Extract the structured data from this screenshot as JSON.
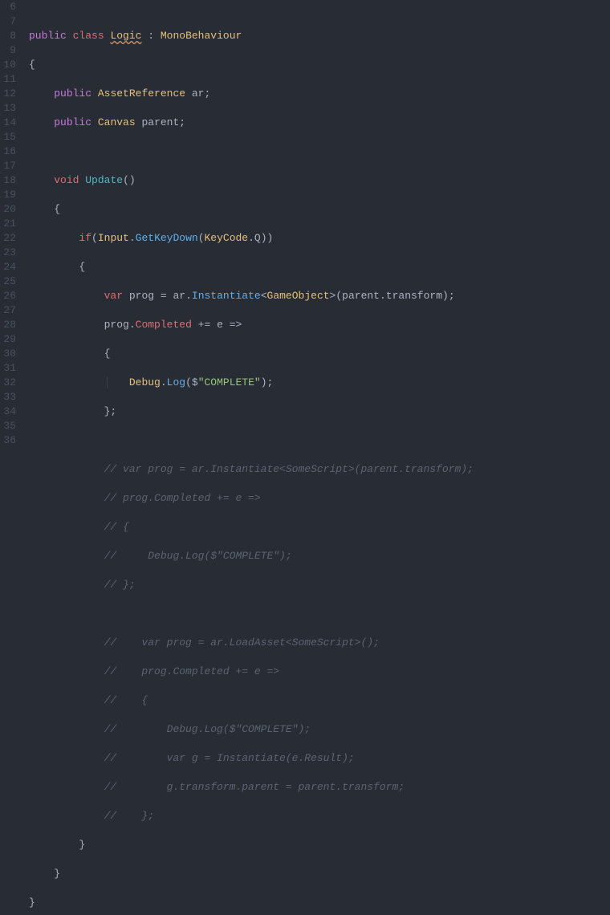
{
  "lines": {
    "start": 6,
    "end": 36
  },
  "code": {
    "l6": {
      "kw_public": "public",
      "kw_class": "class",
      "classname": "Logic",
      "colon": " : ",
      "base": "MonoBehaviour"
    },
    "l7": {
      "brace": "{"
    },
    "l8": {
      "kw_public": "public",
      "type": "AssetReference",
      "name": "ar",
      "semi": ";"
    },
    "l9": {
      "kw_public": "public",
      "type": "Canvas",
      "name": "parent",
      "semi": ";"
    },
    "l11": {
      "kw_void": "void",
      "fn": "Update",
      "parens": "()"
    },
    "l12": {
      "brace": "{"
    },
    "l13": {
      "kw_if": "if",
      "lp": "(",
      "input": "Input",
      "dot": ".",
      "fn": "GetKeyDown",
      "lp2": "(",
      "kc": "KeyCode",
      "dot2": ".",
      "q": "Q",
      "rp": "))"
    },
    "l14": {
      "brace": "{"
    },
    "l15": {
      "kw_var": "var",
      "name": "prog",
      "eq": " = ",
      "ar": "ar",
      "dot": ".",
      "fn": "Instantiate",
      "lt": "<",
      "gtype": "GameObject",
      "gt": ">",
      "lp": "(",
      "parent": "parent",
      "dot2": ".",
      "transform": "transform",
      "rp": ")",
      "semi": ";"
    },
    "l16": {
      "prog": "prog",
      "dot": ".",
      "completed": "Completed",
      "op": " += ",
      "e": "e",
      "arrow": " =>"
    },
    "l17": {
      "brace": "{"
    },
    "l18": {
      "debug": "Debug",
      "dot": ".",
      "fn": "Log",
      "lp": "(",
      "dollar": "$",
      "str": "\"COMPLETE\"",
      "rp": ")",
      "semi": ";"
    },
    "l19": {
      "brace": "};"
    },
    "l21": {
      "text": "// var prog = ar.Instantiate<SomeScript>(parent.transform);"
    },
    "l22": {
      "text": "// prog.Completed += e =>"
    },
    "l23": {
      "text": "// {"
    },
    "l24": {
      "text": "//     Debug.Log($\"COMPLETE\");"
    },
    "l25": {
      "text": "// };"
    },
    "l27": {
      "text": "//    var prog = ar.LoadAsset<SomeScript>();"
    },
    "l28": {
      "text": "//    prog.Completed += e =>"
    },
    "l29": {
      "text": "//    {"
    },
    "l30": {
      "text": "//        Debug.Log($\"COMPLETE\");"
    },
    "l31": {
      "text": "//        var g = Instantiate(e.Result);"
    },
    "l32": {
      "text": "//        g.transform.parent = parent.transform;"
    },
    "l33": {
      "text": "//    };"
    },
    "l34": {
      "brace": "}"
    },
    "l35": {
      "brace": "}"
    },
    "l36": {
      "brace": "}"
    }
  }
}
